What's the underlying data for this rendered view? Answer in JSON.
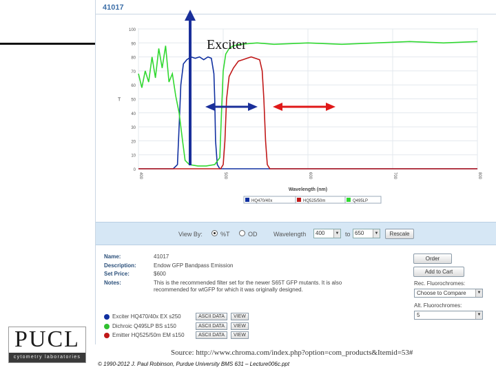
{
  "app": {
    "title": "41017"
  },
  "chart_data": {
    "type": "line",
    "title": "",
    "xlabel": "Wavelength (nm)",
    "ylabel": "T",
    "xlim": [
      400,
      800
    ],
    "ylim": [
      0,
      100
    ],
    "x_ticks": [
      "400",
      "500",
      "600",
      "700",
      "800"
    ],
    "y_ticks": [
      "0",
      "10",
      "20",
      "30",
      "40",
      "50",
      "60",
      "70",
      "80",
      "90",
      "100"
    ],
    "grid": true,
    "legend_position": "bottom",
    "series": [
      {
        "name": "HQ470/40x",
        "color": "#1030a0",
        "points": [
          [
            400,
            0
          ],
          [
            441,
            0
          ],
          [
            446,
            3
          ],
          [
            448,
            30
          ],
          [
            450,
            60
          ],
          [
            453,
            75
          ],
          [
            457,
            78
          ],
          [
            462,
            80
          ],
          [
            467,
            79
          ],
          [
            472,
            80
          ],
          [
            477,
            78
          ],
          [
            482,
            80
          ],
          [
            486,
            79
          ],
          [
            489,
            68
          ],
          [
            490,
            50
          ],
          [
            491,
            20
          ],
          [
            493,
            3
          ],
          [
            496,
            0
          ],
          [
            800,
            0
          ]
        ]
      },
      {
        "name": "HQ525/50m",
        "color": "#c01818",
        "points": [
          [
            400,
            0
          ],
          [
            497,
            0
          ],
          [
            500,
            3
          ],
          [
            502,
            20
          ],
          [
            504,
            50
          ],
          [
            507,
            66
          ],
          [
            512,
            72
          ],
          [
            518,
            77
          ],
          [
            523,
            78
          ],
          [
            528,
            79
          ],
          [
            533,
            80
          ],
          [
            538,
            79
          ],
          [
            543,
            78
          ],
          [
            546,
            70
          ],
          [
            548,
            50
          ],
          [
            550,
            20
          ],
          [
            552,
            3
          ],
          [
            555,
            0
          ],
          [
            800,
            0
          ]
        ]
      },
      {
        "name": "Q495LP",
        "color": "#30d830",
        "points": [
          [
            400,
            68
          ],
          [
            404,
            58
          ],
          [
            408,
            70
          ],
          [
            412,
            62
          ],
          [
            416,
            80
          ],
          [
            420,
            65
          ],
          [
            424,
            86
          ],
          [
            428,
            72
          ],
          [
            432,
            88
          ],
          [
            436,
            62
          ],
          [
            440,
            68
          ],
          [
            444,
            52
          ],
          [
            448,
            40
          ],
          [
            452,
            20
          ],
          [
            455,
            6
          ],
          [
            460,
            3
          ],
          [
            470,
            2
          ],
          [
            480,
            2
          ],
          [
            490,
            3
          ],
          [
            496,
            8
          ],
          [
            498,
            40
          ],
          [
            500,
            70
          ],
          [
            503,
            82
          ],
          [
            507,
            86
          ],
          [
            512,
            88
          ],
          [
            520,
            89
          ],
          [
            540,
            90
          ],
          [
            560,
            89
          ],
          [
            600,
            90
          ],
          [
            640,
            89
          ],
          [
            680,
            90
          ],
          [
            720,
            91
          ],
          [
            760,
            90
          ],
          [
            800,
            91
          ]
        ]
      }
    ]
  },
  "controls": {
    "view_by_label": "View By:",
    "option_percent_t": "%T",
    "option_od": "OD",
    "wavelength_label": "Wavelength",
    "wavelength_from": "400",
    "to_label": "to",
    "wavelength_to": "650",
    "rescale_label": "Rescale"
  },
  "details": {
    "name_label": "Name:",
    "name_value": "41017",
    "description_label": "Description:",
    "description_value": "Endow GFP Bandpass Emission",
    "price_label": "Set Price:",
    "price_value": "$600",
    "notes_label": "Notes:",
    "notes_value": "This is the recommended filter set for the newer S65T GFP mutants. It is also recommended for wtGFP for which it was originally designed."
  },
  "right_panel": {
    "order_label": "Order",
    "add_to_cart_label": "Add to Cart",
    "rec_fluorochromes_label": "Rec. Fluorochromes:",
    "rec_select_value": "Choose to Compare",
    "alt_fluorochromes_label": "Alt. Fluorochromes:",
    "alt_select_value": "5"
  },
  "filters": [
    {
      "role": "Exciter",
      "part": "HQ470/40x",
      "code": "EX s250",
      "color": "#1030a0"
    },
    {
      "role": "Dichroic",
      "part": "Q495LP",
      "code": "BS s150",
      "color": "#30c030"
    },
    {
      "role": "Emitter",
      "part": "HQ525/50m",
      "code": "EM s150",
      "color": "#c01818"
    }
  ],
  "filter_buttons": {
    "ascii_label": "ASCII DATA",
    "view_label": "VIEW"
  },
  "slide": {
    "exciter_label": "Exciter",
    "logo_text": "PUCL",
    "logo_subtext": "cytometry laboratories",
    "source": "Source: http://www.chroma.com/index.php?option=com_products&Itemid=53#",
    "copyright": "© 1990-2012 J. Paul Robinson, Purdue University BMS 631 – Lecture006c.ppt"
  }
}
